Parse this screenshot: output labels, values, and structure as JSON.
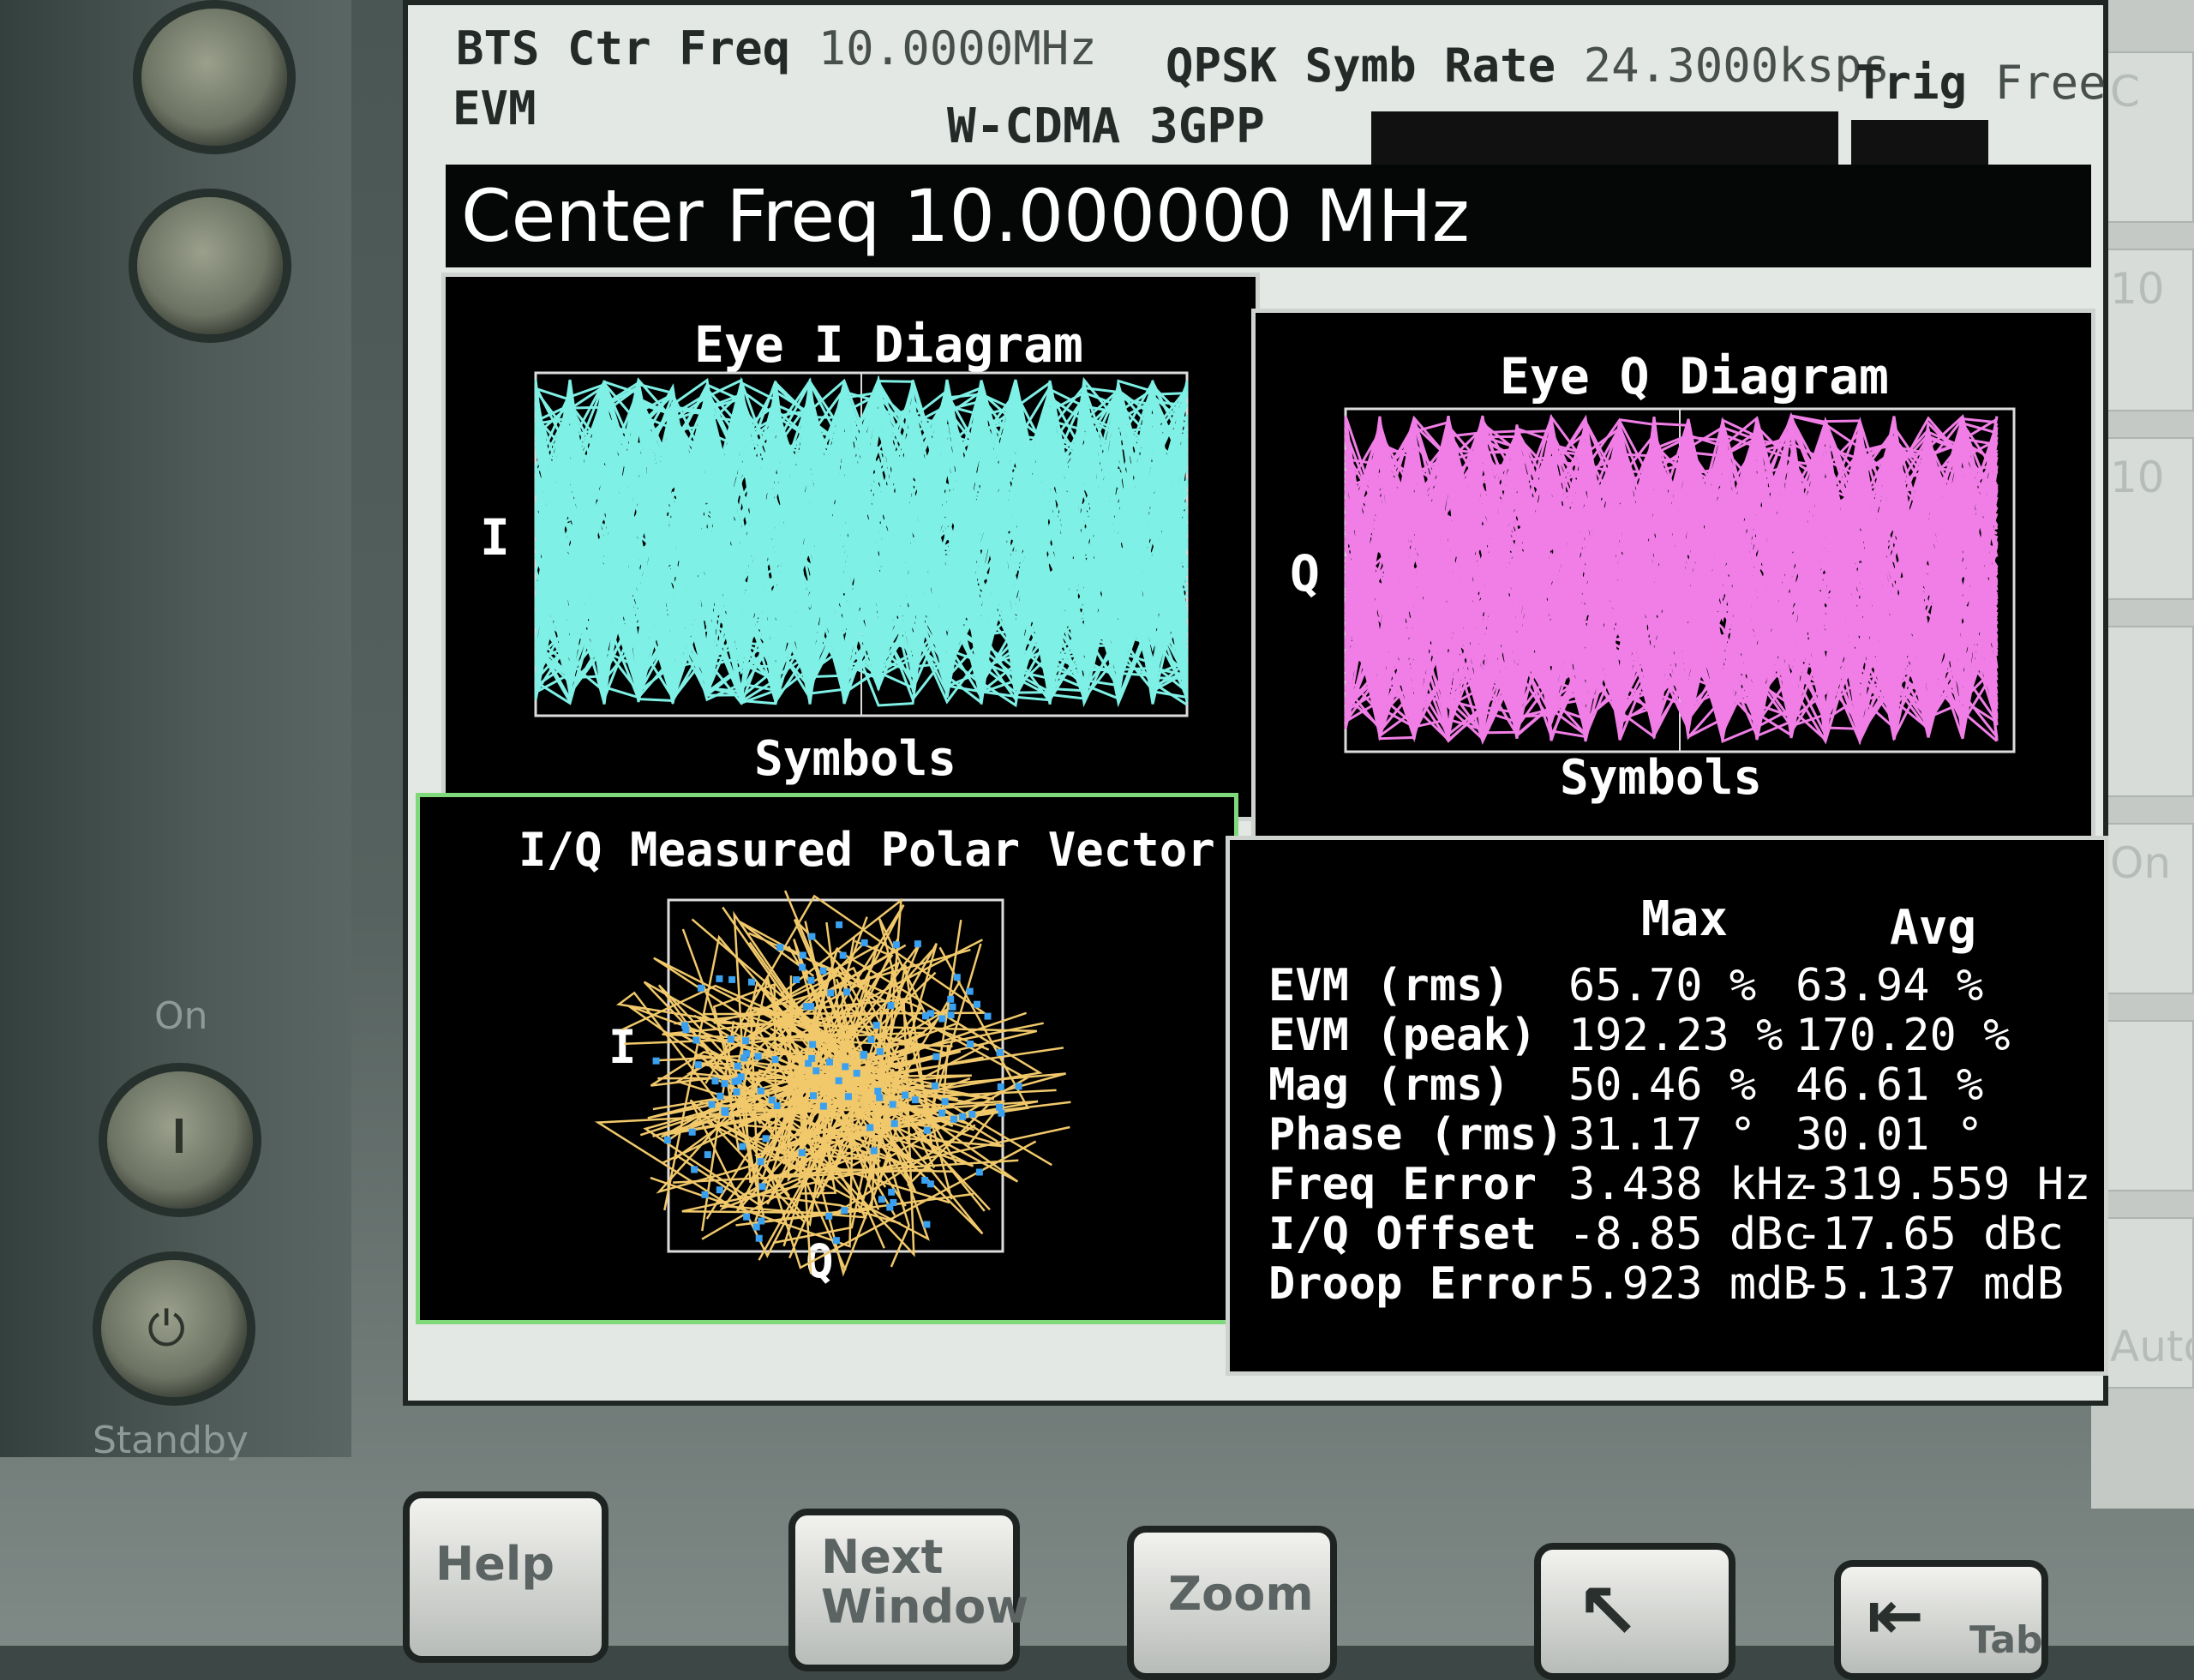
{
  "header": {
    "bts_label": "BTS Ctr Freq",
    "bts_value": "10.0000MHz",
    "mode_label": "QPSK Symb Rate",
    "mode_value": "24.3000ksps",
    "trig_label": "Trig",
    "trig_value": "Free",
    "measurement": "EVM",
    "standard": "W-CDMA 3GPP"
  },
  "active_function": "Center Freq 10.000000 MHz",
  "eye_i": {
    "title": "Eye I Diagram",
    "axis_label": "I",
    "footer": "Symbols",
    "color": "#7ff0e6"
  },
  "eye_q": {
    "title": "Eye Q Diagram",
    "axis_label": "Q",
    "footer": "Symbols",
    "color": "#f07ee6"
  },
  "polar": {
    "title": "I/Q Measured Polar Vector",
    "axis_i": "I",
    "axis_q": "Q",
    "trace_color": "#f1c96b",
    "point_color": "#3aa0f0"
  },
  "results": {
    "columns": [
      "Max",
      "Avg"
    ],
    "rows": [
      {
        "label": "EVM (rms)",
        "max": "65.70 %",
        "avg": "63.94 %"
      },
      {
        "label": "EVM (peak)",
        "max": "192.23 %",
        "avg": "170.20 %"
      },
      {
        "label": "Mag (rms)",
        "max": "50.46 %",
        "avg": "46.61 %"
      },
      {
        "label": "Phase (rms)",
        "max": "31.17 °",
        "avg": "30.01 °"
      },
      {
        "label": "Freq Error",
        "max": "3.438 kHz",
        "avg": "-319.559 Hz"
      },
      {
        "label": "I/Q Offset",
        "max": "-8.85 dBc",
        "avg": "-17.65 dBc"
      },
      {
        "label": "Droop Error",
        "max": "5.923 mdB",
        "avg": "-5.137 mdB"
      }
    ]
  },
  "hardware": {
    "on_label": "On",
    "standby_label": "Standby",
    "keys": [
      "Help",
      "Next Window",
      "Zoom",
      "Tab"
    ]
  },
  "softkeys": [
    "C",
    "1",
    "10",
    "10",
    "On",
    "Auto"
  ]
}
